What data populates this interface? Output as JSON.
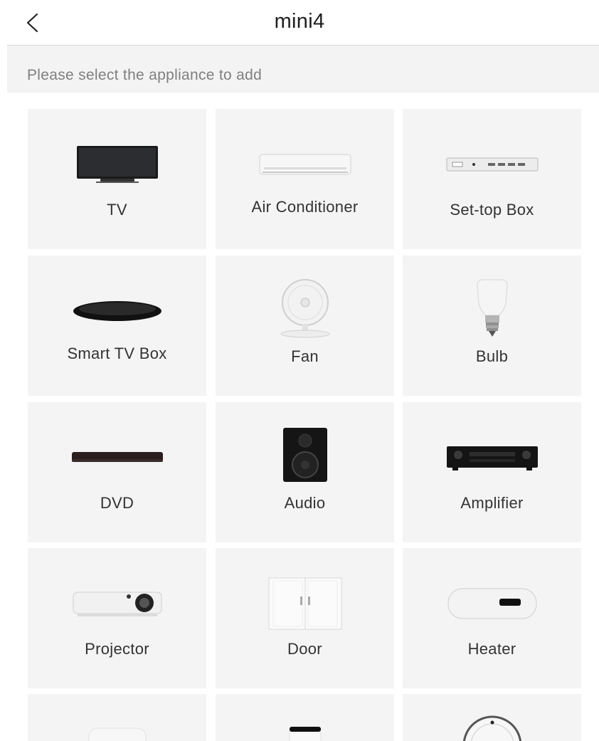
{
  "header": {
    "title": "mini4",
    "back_icon": "chevron-left-icon"
  },
  "prompt": "Please select the appliance to add",
  "appliances": [
    {
      "label": "TV",
      "icon": "tv-icon"
    },
    {
      "label": "Air Conditioner",
      "icon": "air-conditioner-icon"
    },
    {
      "label": "Set-top Box",
      "icon": "set-top-box-icon"
    },
    {
      "label": "Smart TV Box",
      "icon": "smart-tv-box-icon"
    },
    {
      "label": "Fan",
      "icon": "fan-icon"
    },
    {
      "label": "Bulb",
      "icon": "bulb-icon"
    },
    {
      "label": "DVD",
      "icon": "dvd-icon"
    },
    {
      "label": "Audio",
      "icon": "audio-icon"
    },
    {
      "label": "Amplifier",
      "icon": "amplifier-icon"
    },
    {
      "label": "Projector",
      "icon": "projector-icon"
    },
    {
      "label": "Door",
      "icon": "door-icon"
    },
    {
      "label": "Heater",
      "icon": "heater-icon"
    }
  ],
  "partial_row_icons": [
    "humidifier-icon",
    "air-purifier-icon",
    "robot-vacuum-icon"
  ],
  "colors": {
    "tile_bg": "#f4f4f4",
    "prompt_bg": "#f3f3f3",
    "prompt_text": "#7f7f7f",
    "title_text": "#1e1e1e"
  }
}
